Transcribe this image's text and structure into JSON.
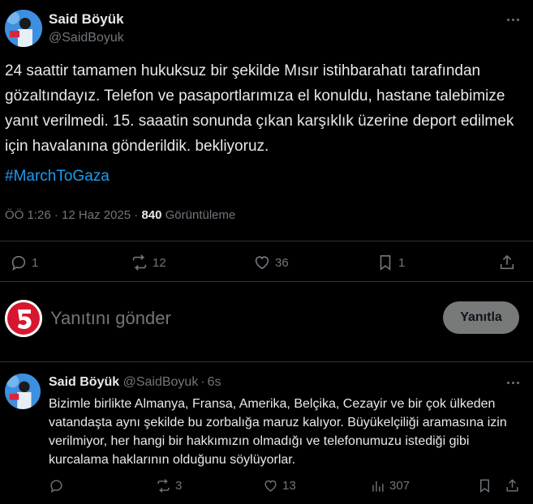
{
  "tweet": {
    "author_name": "Said Böyük",
    "author_handle": "@SaidBoyuk",
    "text": "24 saattir tamamen hukuksuz bir şekilde Mısır istihbarahatı tarafından gözaltındayız. Telefon ve pasaportlarımıza el konuldu, hastane talebimize yanıt verilmedi. 15. saaatin sonunda çıkan karşıklık üzerine deport edilmek için havalanına gönderildik. bekliyoruz.",
    "hashtag": "#MarchToGaza",
    "time": "ÖÖ 1:26 · 12 Haz 2025 ·",
    "views_count": "840",
    "views_label": "Görüntüleme",
    "replies": "1",
    "reposts": "12",
    "likes": "36",
    "bookmarks": "1"
  },
  "composer": {
    "placeholder": "Yanıtını gönder",
    "button": "Yanıtla"
  },
  "reply": {
    "author_name": "Said Böyük",
    "author_handle": "@SaidBoyuk",
    "separator": "·",
    "age": "6s",
    "text": "Bizimle birlikte Almanya, Fransa, Amerika, Belçika, Cezayir ve bir çok ülkeden vatandaşta aynı şekilde bu zorbalığa maruz kalıyor. Büyükelçiliği aramasına izin verilmiyor, her hangi bir hakkımızın olmadığı ve telefonumuzu istediği gibi kurcalama haklarının olduğunu söylüyorlar.",
    "replies": "",
    "reposts": "3",
    "likes": "13",
    "views": "307"
  },
  "colors": {
    "background": "#000000",
    "text": "#e7e9ea",
    "muted": "#71767b",
    "link": "#1d9bf0",
    "divider": "#2f3336"
  }
}
